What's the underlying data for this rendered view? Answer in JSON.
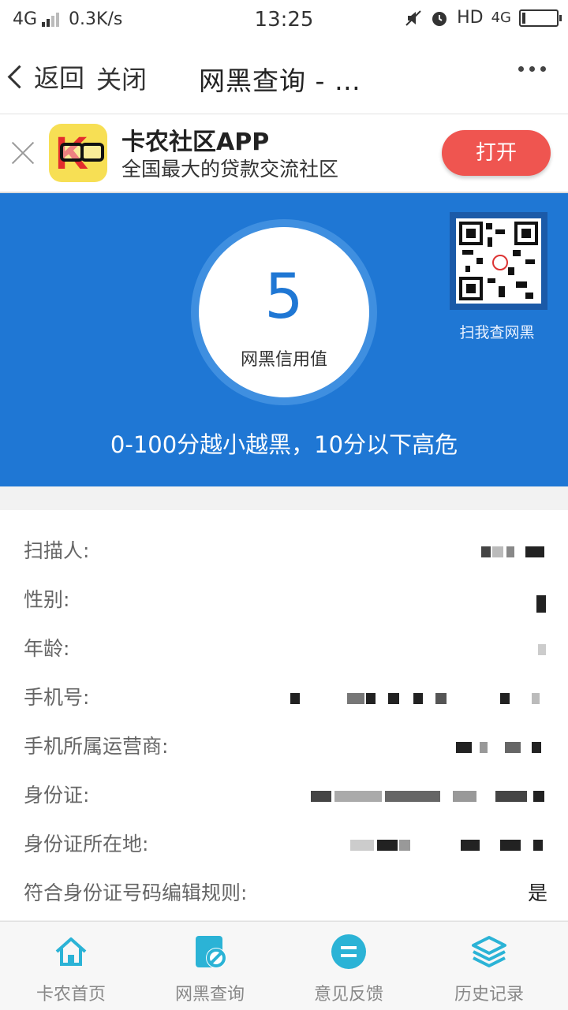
{
  "status_bar": {
    "network": "4G",
    "speed": "0.3K/s",
    "time": "13:25",
    "hd": "HD",
    "network_right": "4G"
  },
  "nav": {
    "back": "返回",
    "close": "关闭",
    "title": "网黑查询 - …"
  },
  "banner": {
    "app_name": "卡农社区APP",
    "description": "全国最大的贷款交流社区",
    "open": "打开"
  },
  "hero": {
    "score": "5",
    "score_label": "网黑信用值",
    "qr_caption": "扫我查网黑",
    "note": "0-100分越小越黑，10分以下高危",
    "color": "#1f77d4"
  },
  "info": [
    {
      "label": "扫描人:",
      "value": ""
    },
    {
      "label": "性别:",
      "value": ""
    },
    {
      "label": "年龄:",
      "value": ""
    },
    {
      "label": "手机号:",
      "value": ""
    },
    {
      "label": "手机所属运营商:",
      "value": ""
    },
    {
      "label": "身份证:",
      "value": ""
    },
    {
      "label": "身份证所在地:",
      "value": ""
    },
    {
      "label": "符合身份证号码编辑规则:",
      "value": "是"
    }
  ],
  "tabs": [
    {
      "label": "卡农首页",
      "icon": "home-icon"
    },
    {
      "label": "网黑查询",
      "icon": "blacklist-query-icon"
    },
    {
      "label": "意见反馈",
      "icon": "feedback-icon"
    },
    {
      "label": "历史记录",
      "icon": "history-layers-icon"
    }
  ]
}
